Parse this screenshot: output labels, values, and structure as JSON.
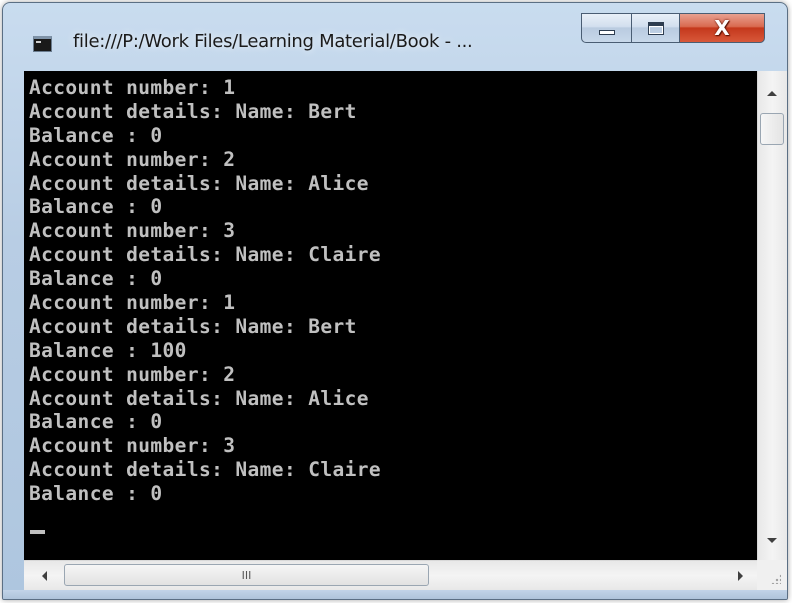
{
  "window": {
    "title": "file:///P:/Work Files/Learning Material/Book - ...",
    "buttons": {
      "minimize": "minimize-icon",
      "maximize": "maximize-icon",
      "close": "close-icon"
    },
    "close_label": "X"
  },
  "console": {
    "lines": [
      "Account number: 1",
      "Account details: Name: Bert",
      "Balance : 0",
      "Account number: 2",
      "Account details: Name: Alice",
      "Balance : 0",
      "Account number: 3",
      "Account details: Name: Claire",
      "Balance : 0",
      "Account number: 1",
      "Account details: Name: Bert",
      "Balance : 100",
      "Account number: 2",
      "Account details: Name: Alice",
      "Balance : 0",
      "Account number: 3",
      "Account details: Name: Claire",
      "Balance : 0"
    ],
    "background": "#000000",
    "text_color": "#c0c0c0"
  },
  "scrollbars": {
    "horizontal_grip": "III"
  }
}
